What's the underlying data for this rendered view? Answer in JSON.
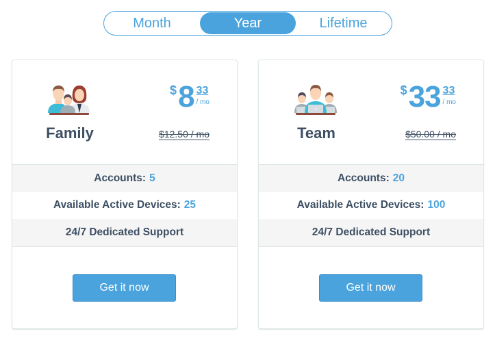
{
  "billing_toggle": {
    "options": [
      {
        "label": "Month",
        "selected": false
      },
      {
        "label": "Year",
        "selected": true
      },
      {
        "label": "Lifetime",
        "selected": false
      }
    ]
  },
  "plans": [
    {
      "name": "Family",
      "icon": "family-icon",
      "price": {
        "currency": "$",
        "integer": "8",
        "cents": "33",
        "period": "/ mo"
      },
      "old_price": "$12.50 / mo",
      "features": [
        {
          "label": "Accounts:",
          "value": "5"
        },
        {
          "label": "Available Active Devices:",
          "value": "25"
        },
        {
          "label": "24/7 Dedicated Support",
          "value": ""
        }
      ],
      "cta": "Get it now"
    },
    {
      "name": "Team",
      "icon": "team-icon",
      "price": {
        "currency": "$",
        "integer": "33",
        "cents": "33",
        "period": "/ mo"
      },
      "old_price": "$50.00 / mo",
      "features": [
        {
          "label": "Accounts:",
          "value": "20"
        },
        {
          "label": "Available Active Devices:",
          "value": "100"
        },
        {
          "label": "24/7 Dedicated Support",
          "value": ""
        }
      ],
      "cta": "Get it now"
    }
  ],
  "colors": {
    "accent": "#4aa3dd",
    "text": "#3d4f63",
    "row_shade": "#f5f5f5"
  }
}
